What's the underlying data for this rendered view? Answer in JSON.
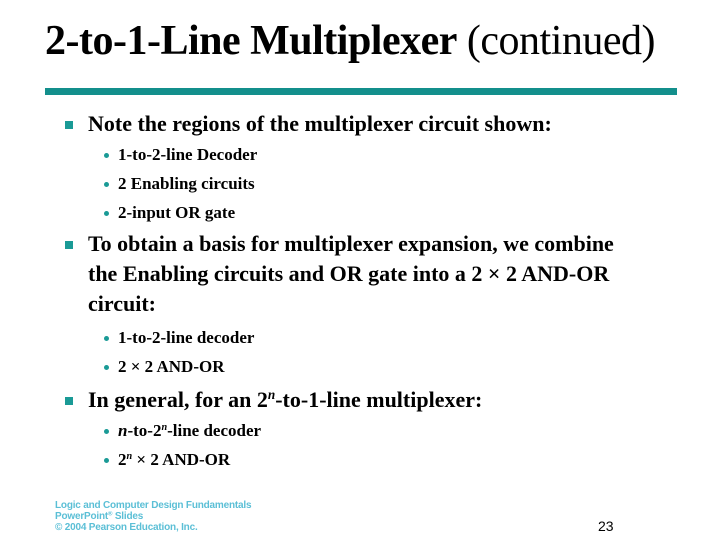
{
  "slide": {
    "title_main": "2-to-1-Line Multiplexer",
    "title_sub": "(continued)",
    "accent_color": "#138f8c",
    "page_number": "23"
  },
  "bullets": [
    {
      "text": "Note the regions of the multiplexer circuit shown:",
      "sub": [
        "1-to-2-line Decoder",
        "2 Enabling circuits",
        "2-input OR gate"
      ]
    },
    {
      "text_lines": [
        "To obtain a basis for multiplexer expansion, we combine",
        "the Enabling circuits and OR gate into a 2 × 2 AND-OR",
        "circuit:"
      ],
      "sub": [
        "1-to-2-line decoder",
        "2 × 2 AND-OR"
      ]
    },
    {
      "text_pre": "In general, for an 2",
      "text_sup": "n",
      "text_post": "-to-1-line multiplexer:",
      "sub": [
        {
          "italic": "n",
          "mid": "-to-2",
          "sup": "n",
          "post": "-line decoder"
        },
        {
          "pre": "2",
          "sup": "n",
          "post": " × 2 AND-OR"
        }
      ]
    }
  ],
  "footer": {
    "line1": "Logic and Computer Design Fundamentals",
    "line2_pre": "PowerPoint",
    "line2_sup": "®",
    "line2_post": " Slides",
    "line3": "© 2004 Pearson Education, Inc."
  }
}
